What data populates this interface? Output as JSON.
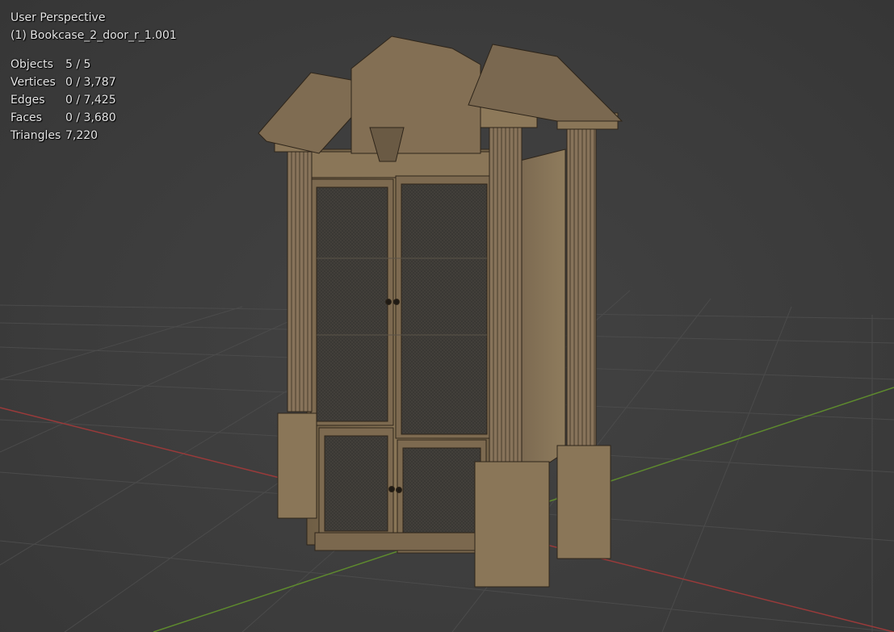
{
  "viewport": {
    "view_name": "User Perspective",
    "active_object": "(1) Bookcase_2_door_r_1.001",
    "stats": [
      {
        "label": "Objects",
        "value": "5 / 5"
      },
      {
        "label": "Vertices",
        "value": "0 / 3,787"
      },
      {
        "label": "Edges",
        "value": "0 / 7,425"
      },
      {
        "label": "Faces",
        "value": "0 / 3,680"
      },
      {
        "label": "Triangles",
        "value": "7,220"
      }
    ]
  },
  "colors": {
    "background": "#3d3d3d",
    "grid_line": "#4a4a4a",
    "x_axis": "#9a3a3a",
    "y_axis": "#5e8a2e",
    "wood": "#8a7556",
    "wood_dark": "#5f4f3a",
    "glass": "#3b3935"
  }
}
